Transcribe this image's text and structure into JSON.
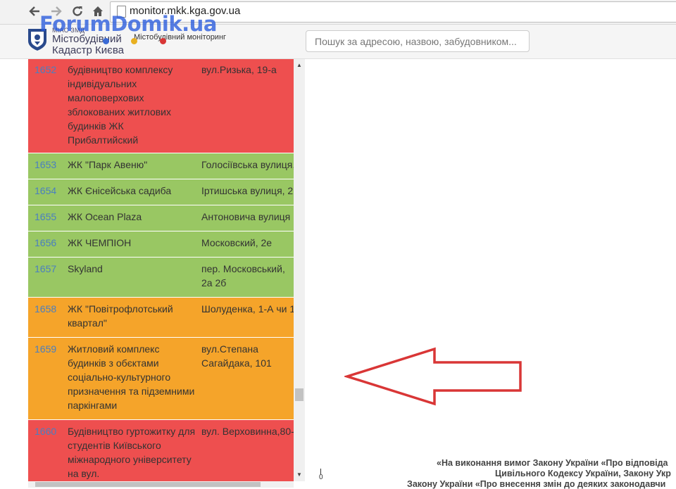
{
  "browser": {
    "url": "monitor.mkk.kga.gov.ua",
    "back_icon": "arrow-left",
    "forward_icon": "arrow-right",
    "reload_icon": "reload",
    "home_icon": "home"
  },
  "header": {
    "brand_small": "МІАС ЗМД",
    "brand_line1": "Містобудівний",
    "brand_line2": "Кадастр Києва",
    "brand_subtitle": "Містобудівний моніторинг",
    "watermark": "ForumDomik.ua",
    "search_placeholder": "Пошук за адресою, назвою, забудовником..."
  },
  "rows": [
    {
      "num": "1652",
      "name": "будівництво комплексу індивідуальних малоповерхових зблокованих житлових будинків ЖК Прибалтийский",
      "addr": "вул.Ризька, 19-а",
      "status": "red"
    },
    {
      "num": "1653",
      "name": "ЖК \"Парк Авеню\"",
      "addr": "Голосіївська вулиця,",
      "status": "green"
    },
    {
      "num": "1654",
      "name": "ЖК Єнісейська садиба",
      "addr": "Іртишська вулиця, 2",
      "status": "green"
    },
    {
      "num": "1655",
      "name": "ЖК Ocean Plaza",
      "addr": "Антоновича вулиця",
      "status": "green"
    },
    {
      "num": "1656",
      "name": "ЖК ЧЕМПІОН",
      "addr": "Московский, 2е",
      "status": "green"
    },
    {
      "num": "1657",
      "name": "Skyland",
      "addr": "пер. Московський, 2а 2б",
      "status": "green"
    },
    {
      "num": "1658",
      "name": "ЖК \"Повітрофлотський квартал\"",
      "addr": "Шолуденка, 1-А чи 1",
      "status": "orange"
    },
    {
      "num": "1659",
      "name": "Житловий комплекс будинків з обєктами соціально-культурного призначення та підземними паркінгами",
      "addr": "вул.Степана Сагайдака, 101",
      "status": "orange"
    },
    {
      "num": "1660",
      "name": "Будівництво гуртожитку для студентів Київського міжнародного університету на вул.",
      "addr": "вул. Верховинна,80-",
      "status": "red"
    }
  ],
  "footer": {
    "line1": "«На виконання вимог Закону України «Про відповіда",
    "line2": "Цивільного Кодексу України, Закону Укр",
    "line3": "Закону України «Про внесення змін до деяких законодавчи",
    "scale_zero": "0"
  },
  "colors": {
    "red": "#ee4f4f",
    "green": "#99c763",
    "orange": "#f5a42a",
    "arrow": "#d93636",
    "link": "#4a7fc0"
  }
}
